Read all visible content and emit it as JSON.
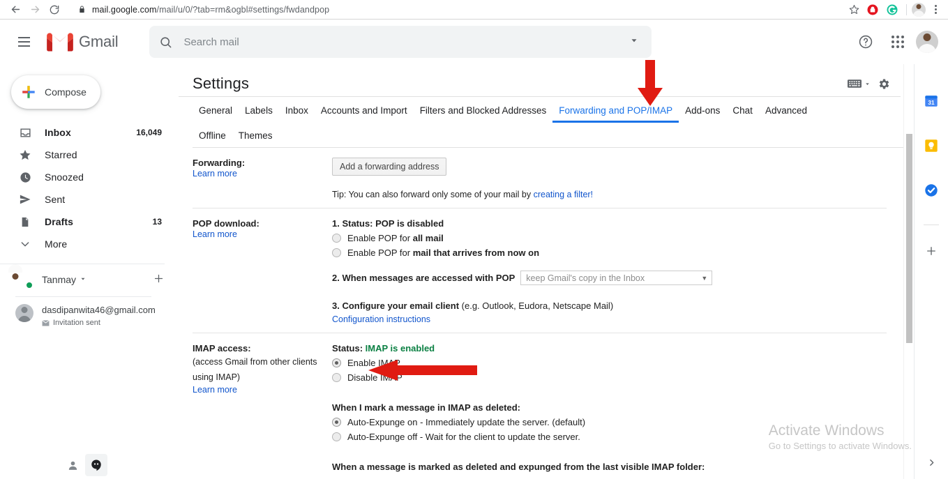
{
  "browser": {
    "url_domain": "mail.google.com",
    "url_path": "/mail/u/0/?tab=rm&ogbl#settings/fwdandpop",
    "back_icon": "back-arrow-icon",
    "forward_icon": "forward-arrow-icon",
    "reload_icon": "reload-icon",
    "lock_icon": "lock-icon",
    "star_icon": "bookmark-star-icon",
    "ext1_icon": "adblock-extension-icon",
    "ext2_icon": "grammarly-extension-icon",
    "menu_icon": "chrome-menu-icon"
  },
  "header": {
    "menu_icon": "hamburger-menu-icon",
    "logo_icon": "gmail-logo-icon",
    "brand": "Gmail",
    "search": {
      "icon": "search-icon",
      "placeholder": "Search mail",
      "value": "",
      "dropdown_icon": "search-options-chevron-icon"
    },
    "help_icon": "help-question-icon",
    "apps_icon": "google-apps-grid-icon",
    "avatar_icon": "account-avatar"
  },
  "sidebar": {
    "compose": {
      "label": "Compose",
      "icon": "compose-plus-icon"
    },
    "items": [
      {
        "label": "Inbox",
        "count": "16,049",
        "icon": "inbox-icon",
        "bold": true
      },
      {
        "label": "Starred",
        "count": "",
        "icon": "star-icon",
        "bold": false
      },
      {
        "label": "Snoozed",
        "count": "",
        "icon": "clock-icon",
        "bold": false
      },
      {
        "label": "Sent",
        "count": "",
        "icon": "send-icon",
        "bold": false
      },
      {
        "label": "Drafts",
        "count": "13",
        "icon": "draft-icon",
        "bold": true
      },
      {
        "label": "More",
        "count": "",
        "icon": "chevron-down-icon",
        "bold": false
      }
    ],
    "account": {
      "name": "Tanmay",
      "caret_icon": "chevron-down-icon",
      "add_icon": "add-account-plus-icon"
    },
    "contact": {
      "email": "dasdipanwita46@gmail.com",
      "status": "Invitation sent",
      "status_icon": "envelope-icon"
    },
    "footer": {
      "contacts_icon": "person-icon",
      "hangouts_icon": "hangouts-chat-icon"
    }
  },
  "settings": {
    "title": "Settings",
    "tools": {
      "keyboard_icon": "input-tools-keyboard-icon",
      "keyboard_caret_icon": "chevron-down-icon",
      "gear_icon": "gear-icon"
    },
    "tabs": [
      {
        "label": "General",
        "active": false
      },
      {
        "label": "Labels",
        "active": false
      },
      {
        "label": "Inbox",
        "active": false
      },
      {
        "label": "Accounts and Import",
        "active": false
      },
      {
        "label": "Filters and Blocked Addresses",
        "active": false
      },
      {
        "label": "Forwarding and POP/IMAP",
        "active": true
      },
      {
        "label": "Add-ons",
        "active": false
      },
      {
        "label": "Chat",
        "active": false
      },
      {
        "label": "Advanced",
        "active": false
      },
      {
        "label": "Offline",
        "active": false
      },
      {
        "label": "Themes",
        "active": false
      }
    ],
    "forwarding": {
      "label": "Forwarding:",
      "learn_more": "Learn more",
      "add_button": "Add a forwarding address",
      "tip_prefix": "Tip: You can also forward only some of your mail by ",
      "tip_link": "creating a filter!"
    },
    "pop": {
      "label": "POP download:",
      "learn_more": "Learn more",
      "status": "1. Status: POP is disabled",
      "option1_prefix": "Enable POP for ",
      "option1_bold": "all mail",
      "option1_checked": false,
      "option2_prefix": "Enable POP for ",
      "option2_bold": "mail that arrives from now on",
      "option2_checked": false,
      "step2": "2. When messages are accessed with POP",
      "step2_select_value": "keep Gmail's copy in the Inbox",
      "step2_select_caret": "chevron-down-icon",
      "step3_bold": "3. Configure your email client",
      "step3_norm": " (e.g. Outlook, Eudora, Netscape Mail)",
      "step3_link": "Configuration instructions"
    },
    "imap": {
      "label": "IMAP access:",
      "sub1": "(access Gmail from other clients",
      "sub2": "using IMAP)",
      "learn_more": "Learn more",
      "status_prefix": "Status: ",
      "status_value": "IMAP is enabled",
      "enable_label": "Enable IMAP",
      "enable_checked": true,
      "disable_label": "Disable IMAP",
      "disable_checked": false,
      "deleted_heading": "When I mark a message in IMAP as deleted:",
      "expunge_on": "Auto-Expunge on - Immediately update the server. (default)",
      "expunge_on_checked": true,
      "expunge_off": "Auto-Expunge off - Wait for the client to update the server.",
      "expunge_off_checked": false,
      "expunged_heading": "When a message is marked as deleted and expunged from the last visible IMAP folder:"
    }
  },
  "right_rail": {
    "calendar_icon": "google-calendar-icon",
    "calendar_day": "31",
    "keep_icon": "google-keep-icon",
    "tasks_icon": "google-tasks-icon",
    "add_icon": "add-addon-plus-icon",
    "expand_icon": "chevron-right-icon"
  },
  "watermark": {
    "title": "Activate Windows",
    "subtitle": "Go to Settings to activate Windows."
  },
  "annotations": {
    "arrow_down_icon": "red-down-arrow-annotation",
    "arrow_left_icon": "red-left-arrow-annotation",
    "accent_red": "#e01b12",
    "accent_blue": "#1a73e8",
    "accent_green": "#0b8043"
  }
}
